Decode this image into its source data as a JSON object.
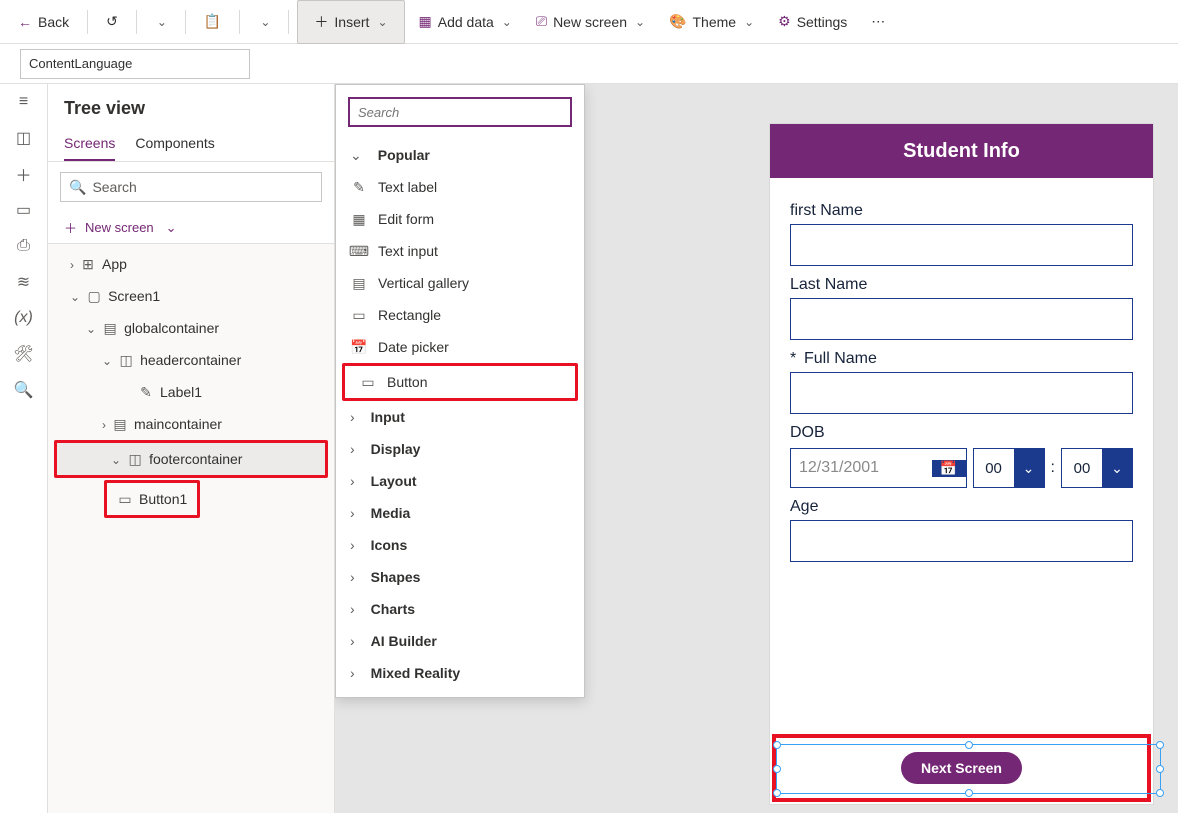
{
  "toolbar": {
    "back": "Back",
    "insert": "Insert",
    "add_data": "Add data",
    "new_screen": "New screen",
    "theme": "Theme",
    "settings": "Settings"
  },
  "property_box": "ContentLanguage",
  "tree": {
    "title": "Tree view",
    "tabs": {
      "screens": "Screens",
      "components": "Components"
    },
    "search_ph": "Search",
    "new_screen": "New screen",
    "items": {
      "app": "App",
      "screen1": "Screen1",
      "global": "globalcontainer",
      "header": "headercontainer",
      "label1": "Label1",
      "main": "maincontainer",
      "footer": "footercontainer",
      "button1": "Button1"
    }
  },
  "insert_menu": {
    "search_ph": "Search",
    "popular": "Popular",
    "items": {
      "text_label": "Text label",
      "edit_form": "Edit form",
      "text_input": "Text input",
      "vertical_gallery": "Vertical gallery",
      "rectangle": "Rectangle",
      "date_picker": "Date picker",
      "button": "Button"
    },
    "cats": {
      "input": "Input",
      "display": "Display",
      "layout": "Layout",
      "media": "Media",
      "icons": "Icons",
      "shapes": "Shapes",
      "charts": "Charts",
      "ai": "AI Builder",
      "mr": "Mixed Reality"
    }
  },
  "form": {
    "title": "Student Info",
    "first": "first Name",
    "last": "Last Name",
    "full": "Full Name",
    "dob_lbl": "DOB",
    "dob_val": "12/31/2001",
    "hour": "00",
    "min": "00",
    "age": "Age",
    "next": "Next Screen"
  }
}
